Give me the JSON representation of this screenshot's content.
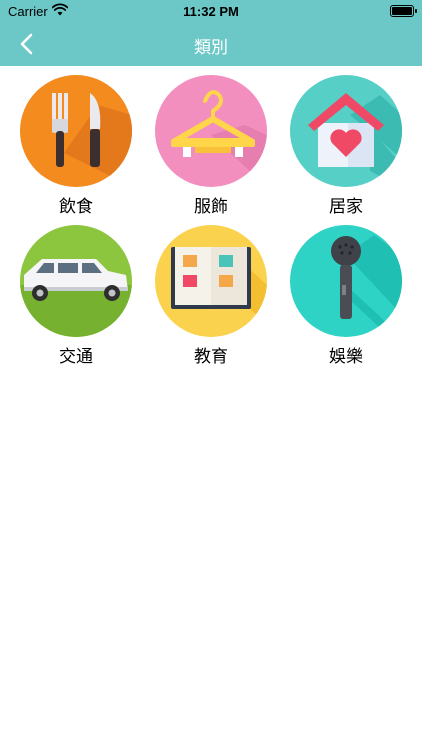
{
  "status_bar": {
    "carrier": "Carrier",
    "time": "11:32 PM"
  },
  "nav_bar": {
    "title": "類別",
    "back_icon": "chevron-left-icon"
  },
  "categories": [
    {
      "label": "飲食",
      "icon": "fork-knife-icon",
      "color": "#f38b1f"
    },
    {
      "label": "服飾",
      "icon": "hanger-icon",
      "color": "#f28fbf"
    },
    {
      "label": "居家",
      "icon": "house-heart-icon",
      "color": "#56cfc6"
    },
    {
      "label": "交通",
      "icon": "car-icon",
      "color": "#8cc63f"
    },
    {
      "label": "教育",
      "icon": "book-icon",
      "color": "#fbd24e"
    },
    {
      "label": "娛樂",
      "icon": "microphone-icon",
      "color": "#2fd3c6"
    }
  ]
}
